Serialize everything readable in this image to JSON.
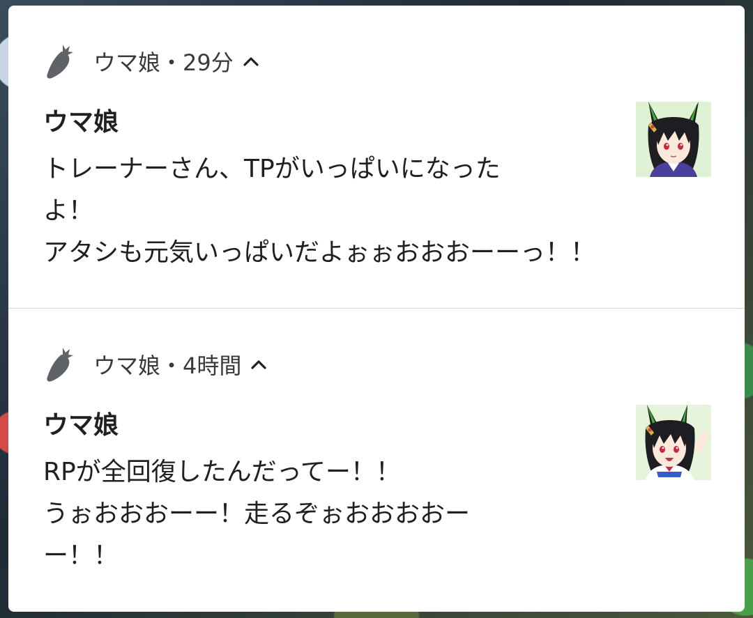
{
  "notifications": [
    {
      "app_name": "ウマ娘",
      "separator": "・",
      "time": "29分",
      "header": "ウマ娘・29分",
      "expand_icon": "chevron-up-icon",
      "app_icon": "carrot-icon",
      "title": "ウマ娘",
      "lines": [
        "トレーナーさん、TPがいっぱいになった",
        "よ！",
        "アタシも元気いっぱいだよぉぉおおおーーっ！！"
      ],
      "thumbnail": "character-avatar"
    },
    {
      "app_name": "ウマ娘",
      "separator": "・",
      "time": "4時間",
      "header": "ウマ娘・4時間",
      "expand_icon": "chevron-up-icon",
      "app_icon": "carrot-icon",
      "title": "ウマ娘",
      "lines": [
        "RPが全回復したんだってー！！",
        "うぉおおおーー！走るぞぉおおおおー",
        "ー！！"
      ],
      "thumbnail": "character-avatar"
    }
  ],
  "colors": {
    "panel_bg": "#ffffff",
    "text_primary": "#202020",
    "text_secondary": "#3a3a3a",
    "icon_gray": "#5f6368",
    "divider": "#d6d6d6"
  }
}
